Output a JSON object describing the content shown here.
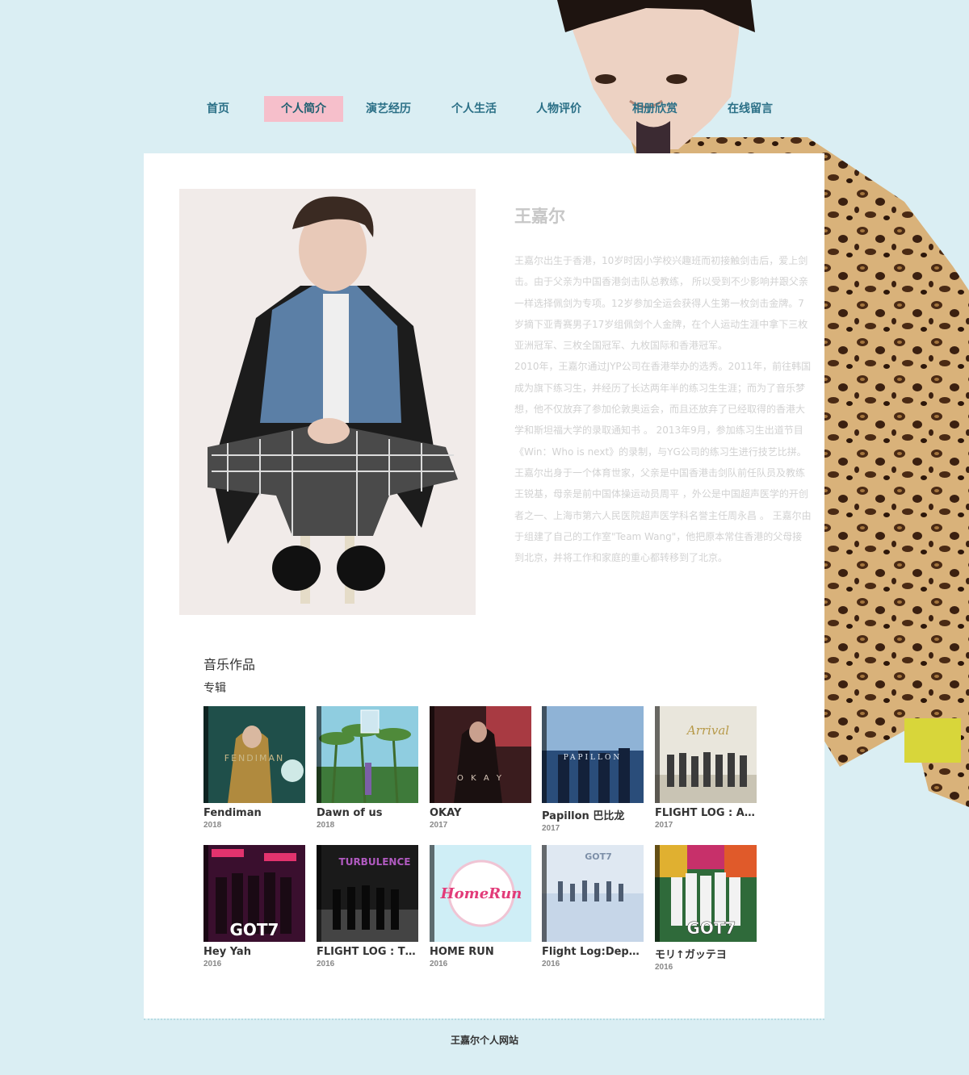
{
  "nav": {
    "items": [
      {
        "label": "首页",
        "active": false
      },
      {
        "label": "个人简介",
        "active": true
      },
      {
        "label": "演艺经历",
        "active": false
      },
      {
        "label": "个人生活",
        "active": false
      },
      {
        "label": "人物评价",
        "active": false
      },
      {
        "label": "相册欣赏",
        "active": false
      },
      {
        "label": "在线留言",
        "active": false
      }
    ]
  },
  "profile": {
    "name": "王嘉尔",
    "bio": [
      "王嘉尔出生于香港，10岁时因小学校兴趣班而初接触剑击后，爱上剑击。由于父亲为中国香港剑击队总教练， 所以受到不少影响并跟父亲一样选择佩剑为专项。12岁参加全运会获得人生第一枚剑击金牌。7岁摘下亚青赛男子17岁组佩剑个人金牌，在个人运动生涯中拿下三枚亚洲冠军、三枚全国冠军、九枚国际和香港冠军。",
      "2010年，王嘉尔通过JYP公司在香港举办的选秀。2011年，前往韩国成为旗下练习生，并经历了长达两年半的练习生生涯；而为了音乐梦想，他不仅放弃了参加伦敦奥运会，而且还放弃了已经取得的香港大学和斯坦福大学的录取通知书 。 2013年9月，参加练习生出道节目《Win：Who is next》的录制，与YG公司的练习生进行技艺比拼。",
      "王嘉尔出身于一个体育世家，父亲是中国香港击剑队前任队员及教练王锐基，母亲是前中国体操运动员周平 ，外公是中国超声医学的开创者之一、上海市第六人民医院超声医学科名誉主任周永昌 。 王嘉尔由于组建了自己的工作室\"Team Wang\"，他把原本常住香港的父母接到北京，并将工作和家庭的重心都转移到了北京。"
    ]
  },
  "music": {
    "section_title": "音乐作品",
    "subsection_title": "专辑",
    "albums": [
      {
        "title": "Fendiman",
        "year": "2018",
        "cover_text": "FENDIMAN"
      },
      {
        "title": "Dawn of us",
        "year": "2018",
        "cover_text": ""
      },
      {
        "title": "OKAY",
        "year": "2017",
        "cover_text": "O K A Y"
      },
      {
        "title": "Papillon 巴比龙",
        "year": "2017",
        "cover_text": "PAPILLON"
      },
      {
        "title": "FLIGHT LOG : ARR...",
        "year": "2017",
        "cover_text": "Arrival"
      },
      {
        "title": "Hey Yah",
        "year": "2016",
        "cover_text": "GOT7"
      },
      {
        "title": "FLIGHT LOG : TUR...",
        "year": "2016",
        "cover_text": "TURBULENCE"
      },
      {
        "title": "HOME RUN",
        "year": "2016",
        "cover_text": "HomeRun"
      },
      {
        "title": "Flight Log:Depart...",
        "year": "2016",
        "cover_text": "GOT7"
      },
      {
        "title": "モリ↑ガッテヨ",
        "year": "2016",
        "cover_text": "GOT7"
      }
    ]
  },
  "footer": {
    "text": "王嘉尔个人网站"
  }
}
